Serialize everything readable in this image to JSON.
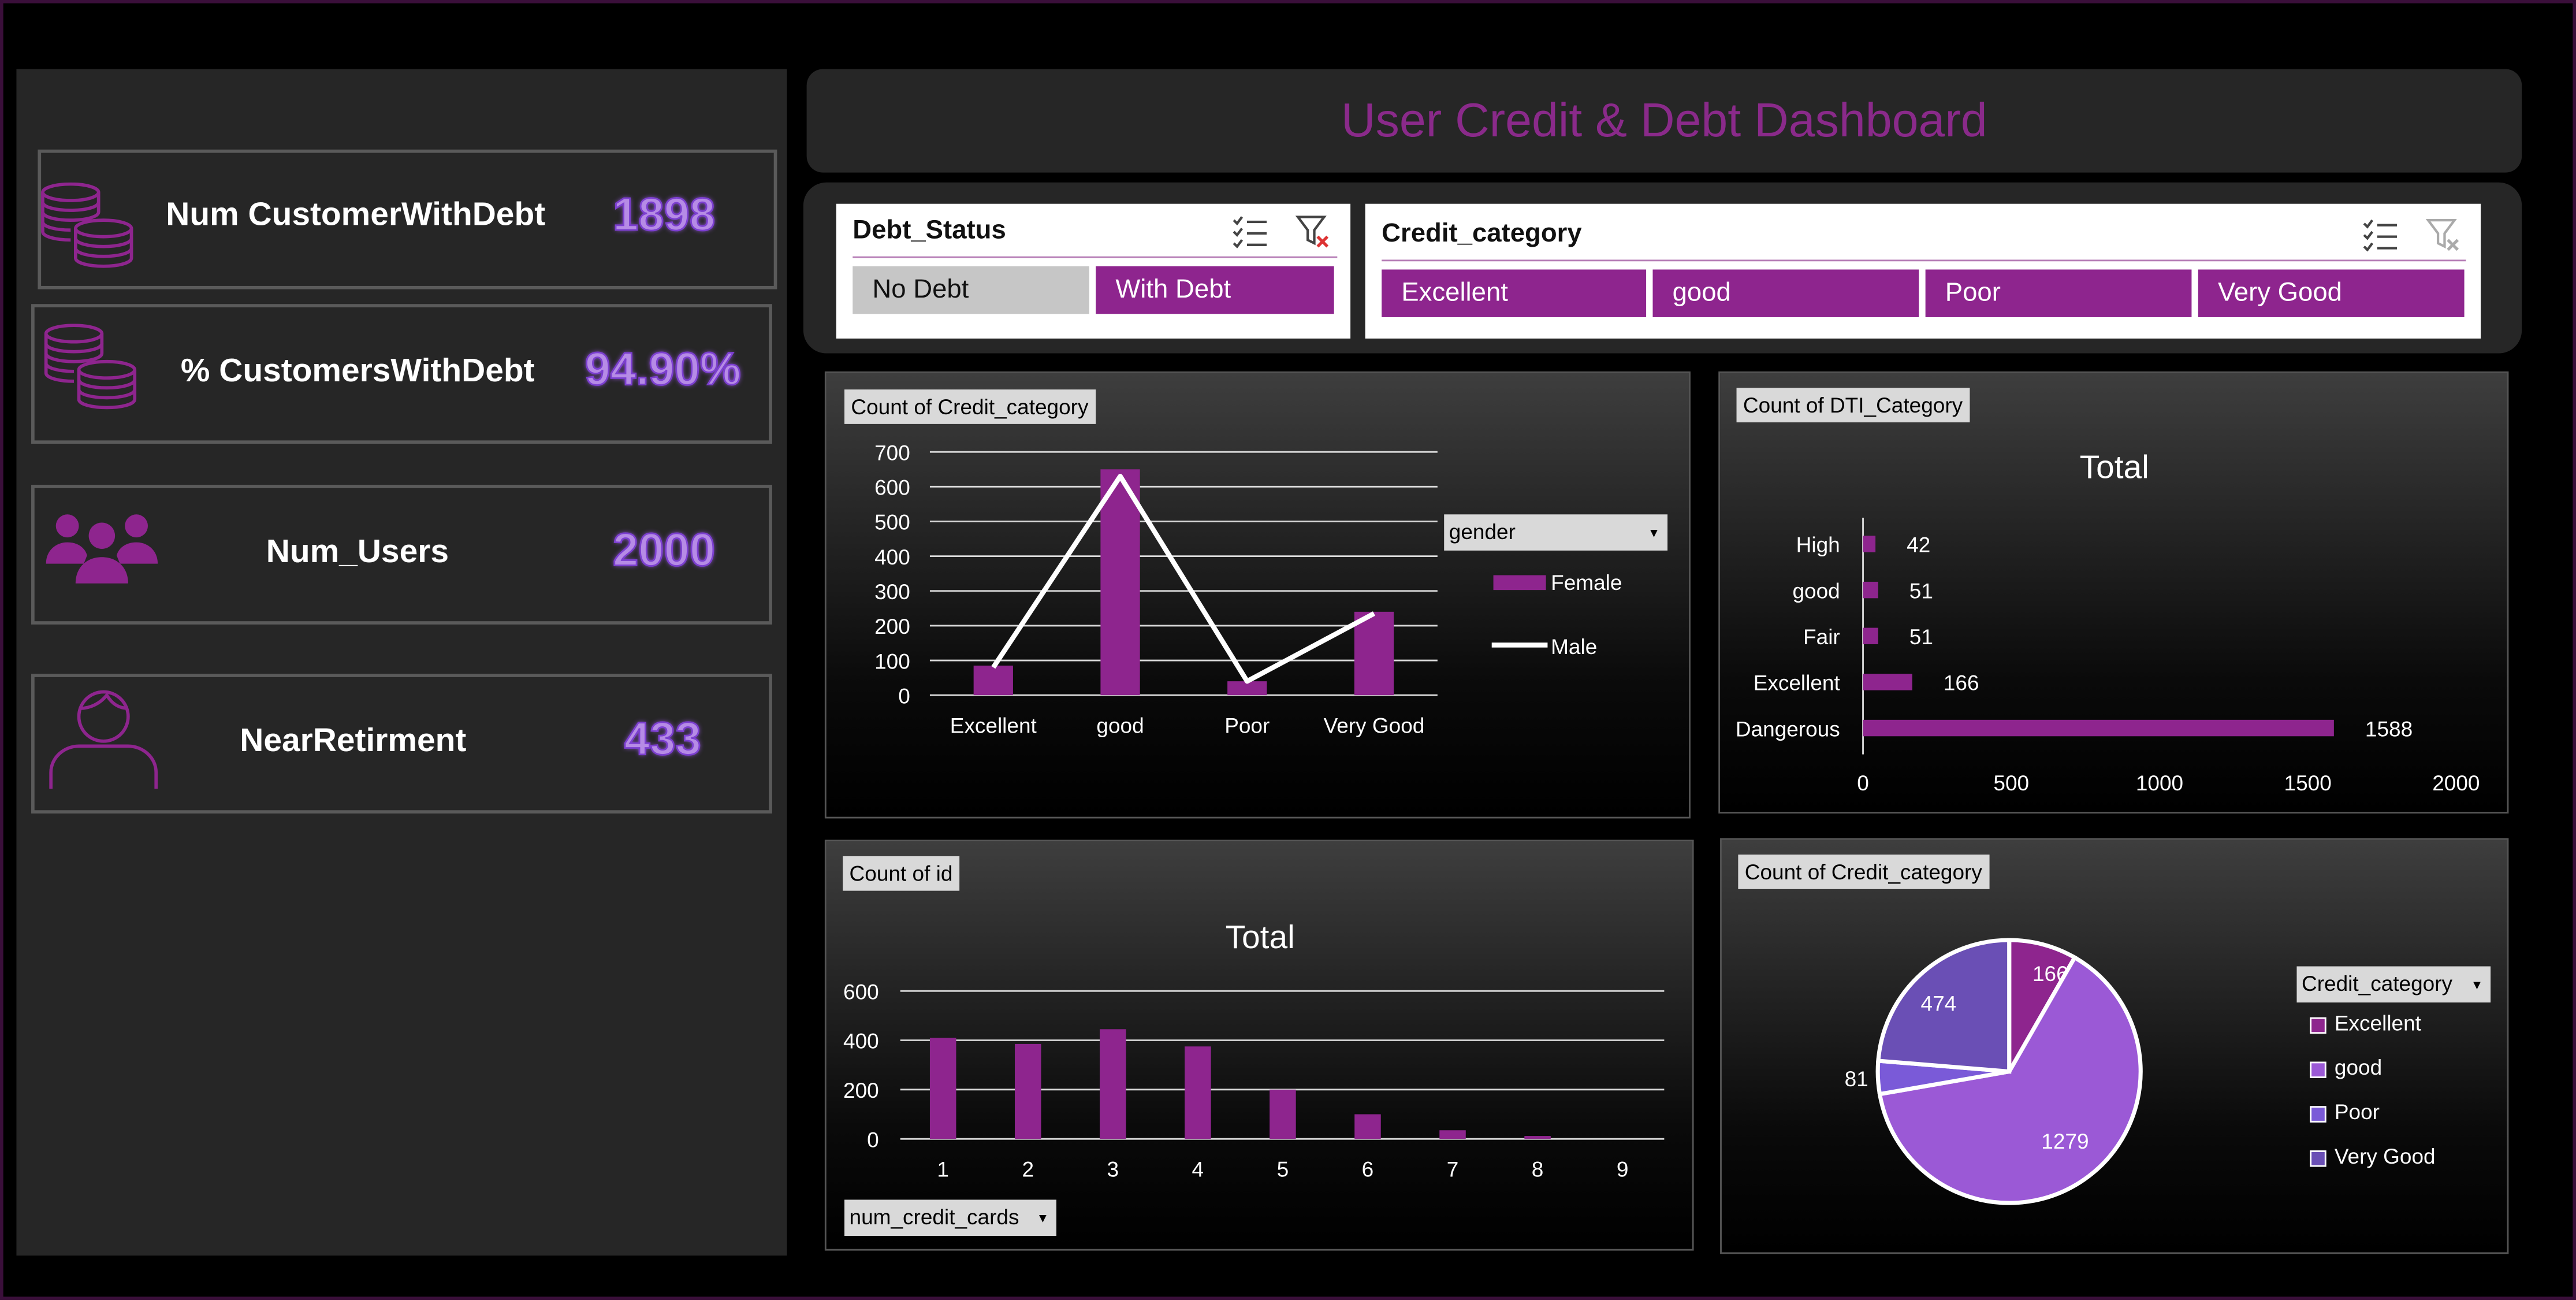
{
  "title": "User Credit & Debt Dashboard",
  "kpis": [
    {
      "label": "Num CustomerWithDebt",
      "value": "1898",
      "icon": "coins-icon"
    },
    {
      "label": "% CustomersWithDebt",
      "value": "94.90%",
      "icon": "coins-icon"
    },
    {
      "label": "Num_Users",
      "value": "2000",
      "icon": "users-group-icon"
    },
    {
      "label": "NearRetirment",
      "value": "433",
      "icon": "user-outline-icon"
    }
  ],
  "slicers": {
    "debt_status": {
      "title": "Debt_Status",
      "items": [
        {
          "label": "No Debt",
          "selected": false
        },
        {
          "label": "With Debt",
          "selected": true
        }
      ]
    },
    "credit_category": {
      "title": "Credit_category",
      "items": [
        {
          "label": "Excellent",
          "selected": true
        },
        {
          "label": "good",
          "selected": true
        },
        {
          "label": "Poor",
          "selected": true
        },
        {
          "label": "Very Good",
          "selected": true
        }
      ]
    }
  },
  "colors": {
    "accent": "#8e258e",
    "title": "#8a2a8a",
    "kpi_value": "#b68be6",
    "pie_excellent": "#8e258e",
    "pie_good": "#9b59d6",
    "pie_poor": "#7a5ad8",
    "pie_verygood": "#6a4fb5"
  },
  "chart_data": [
    {
      "type": "bar",
      "tag": "Count of Credit_category",
      "categories": [
        "Excellent",
        "good",
        "Poor",
        "Very Good"
      ],
      "series": [
        {
          "name": "Female",
          "kind": "bar",
          "values": [
            85,
            650,
            40,
            240
          ]
        },
        {
          "name": "Male",
          "kind": "line",
          "values": [
            80,
            630,
            40,
            235
          ]
        }
      ],
      "ylim": [
        0,
        700
      ],
      "yticks": [
        0,
        100,
        200,
        300,
        400,
        500,
        600,
        700
      ],
      "legend_title": "gender",
      "legend": "right",
      "grid": true
    },
    {
      "type": "bar",
      "orientation": "horizontal",
      "tag": "Count of DTI_Category",
      "title": "Total",
      "categories": [
        "High",
        "good",
        "Fair",
        "Excellent",
        "Dangerous"
      ],
      "values": [
        42,
        51,
        51,
        166,
        1588
      ],
      "xlim": [
        0,
        2000
      ],
      "xticks": [
        0,
        500,
        1000,
        1500,
        2000
      ]
    },
    {
      "type": "bar",
      "tag": "Count of id",
      "title": "Total",
      "categories": [
        "1",
        "2",
        "3",
        "4",
        "5",
        "6",
        "7",
        "8",
        "9"
      ],
      "values": [
        410,
        385,
        445,
        375,
        200,
        100,
        35,
        12,
        0
      ],
      "ylim": [
        0,
        600
      ],
      "yticks": [
        0,
        200,
        400,
        600
      ],
      "filter": "num_credit_cards",
      "grid": true
    },
    {
      "type": "pie",
      "tag": "Count of Credit_category",
      "legend_title": "Credit_category",
      "legend": "right",
      "slices": [
        {
          "label": "Excellent",
          "value": 166
        },
        {
          "label": "good",
          "value": 1279
        },
        {
          "label": "Poor",
          "value": 81
        },
        {
          "label": "Very Good",
          "value": 474
        }
      ]
    }
  ]
}
